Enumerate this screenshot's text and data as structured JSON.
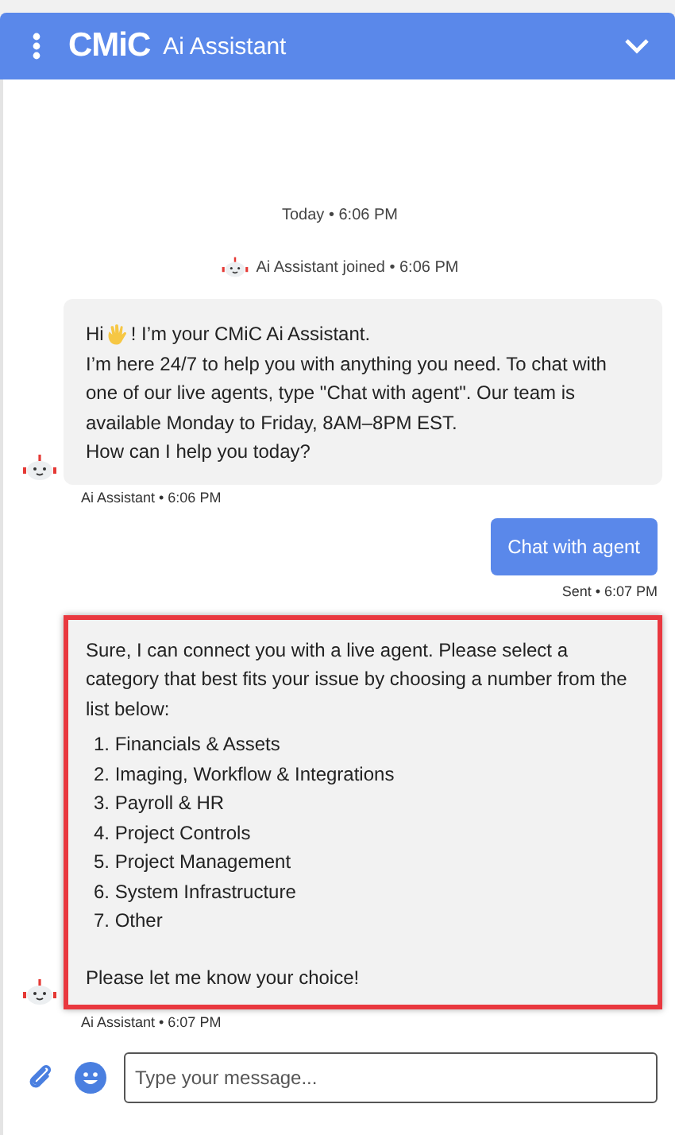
{
  "header": {
    "logo": "CMiC",
    "title": "Ai Assistant"
  },
  "messages": [
    {
      "kind": "divider",
      "text": "Today • 6:06 PM"
    },
    {
      "kind": "event",
      "text": "Ai Assistant joined • 6:06 PM"
    },
    {
      "kind": "bot",
      "greeting": "Hi",
      "greeting_rest": "! I’m your CMiC Ai Assistant.",
      "lines": [
        "I’m here 24/7 to help you with anything you need. To chat with one of our live agents, type \"Chat with agent\". Our team is available Monday to Friday, 8AM–8PM EST.",
        "How can I help you today?"
      ],
      "meta": "Ai Assistant • 6:06 PM",
      "highlighted": false
    },
    {
      "kind": "user",
      "text": "Chat with agent",
      "meta": "Sent • 6:07 PM"
    },
    {
      "kind": "bot",
      "lines": [
        "Sure, I can connect you with a live agent. Please select a category that best fits your issue by choosing a number from the list below:"
      ],
      "list": [
        "1. Financials & Assets",
        "2. Imaging, Workflow & Integrations",
        "3. Payroll & HR",
        "4. Project Controls",
        "5. Project Management",
        "6. System Infrastructure",
        "7. Other"
      ],
      "closing": "Please let me know your choice!",
      "meta": "Ai Assistant • 6:07 PM",
      "highlighted": true
    }
  ],
  "composer": {
    "placeholder": "Type your message..."
  }
}
